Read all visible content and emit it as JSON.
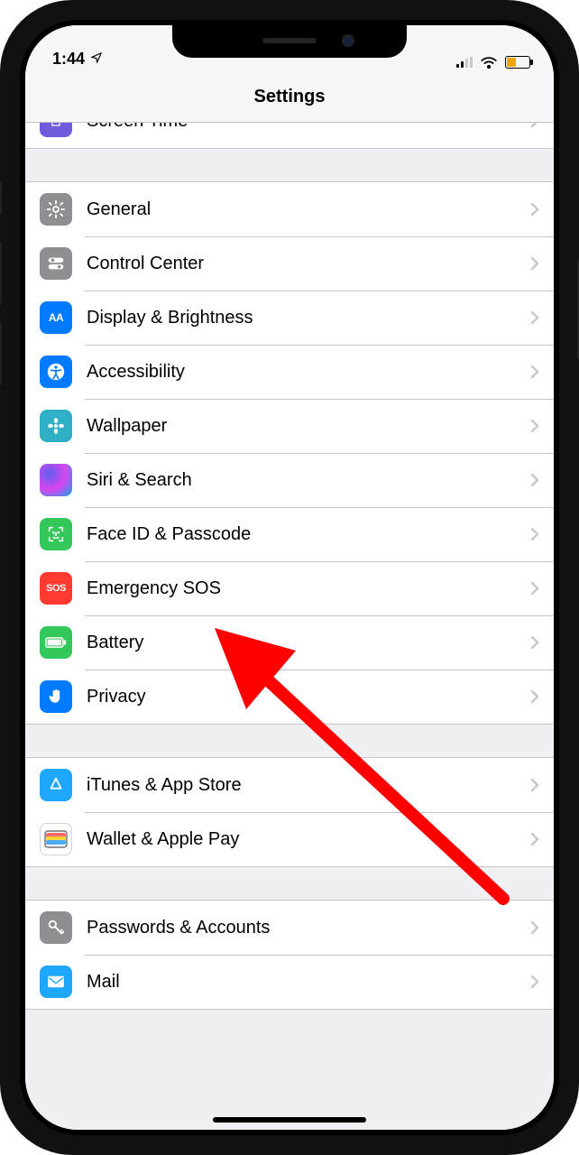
{
  "statusbar": {
    "time": "1:44",
    "location_services": true,
    "cell_bars": 2,
    "wifi": true,
    "battery_color": "#f0a500",
    "battery_low_power": true
  },
  "header": {
    "title": "Settings"
  },
  "groups": [
    {
      "rows": [
        {
          "id": "screen-time",
          "label": "Screen Time",
          "icon": "hourglass-icon",
          "icon_bg": "#6f5bdc"
        }
      ]
    },
    {
      "rows": [
        {
          "id": "general",
          "label": "General",
          "icon": "gear-icon",
          "icon_bg": "#8e8e93"
        },
        {
          "id": "control-center",
          "label": "Control Center",
          "icon": "switches-icon",
          "icon_bg": "#8e8e93"
        },
        {
          "id": "display",
          "label": "Display & Brightness",
          "icon": "text-size-icon",
          "icon_bg": "#007aff"
        },
        {
          "id": "accessibility",
          "label": "Accessibility",
          "icon": "accessibility-icon",
          "icon_bg": "#007aff"
        },
        {
          "id": "wallpaper",
          "label": "Wallpaper",
          "icon": "flower-icon",
          "icon_bg": "#30b0c7"
        },
        {
          "id": "siri",
          "label": "Siri & Search",
          "icon": "siri-icon",
          "icon_bg": "grad"
        },
        {
          "id": "faceid",
          "label": "Face ID & Passcode",
          "icon": "faceid-icon",
          "icon_bg": "#34c759"
        },
        {
          "id": "sos",
          "label": "Emergency SOS",
          "icon": "sos-icon",
          "icon_bg": "#ff3b30"
        },
        {
          "id": "battery",
          "label": "Battery",
          "icon": "battery-icon",
          "icon_bg": "#34c759"
        },
        {
          "id": "privacy",
          "label": "Privacy",
          "icon": "hand-icon",
          "icon_bg": "#007aff"
        }
      ]
    },
    {
      "rows": [
        {
          "id": "itunes",
          "label": "iTunes & App Store",
          "icon": "appstore-icon",
          "icon_bg": "#1ea7fd"
        },
        {
          "id": "wallet",
          "label": "Wallet & Apple Pay",
          "icon": "wallet-icon",
          "icon_bg": "white"
        }
      ]
    },
    {
      "rows": [
        {
          "id": "passwords",
          "label": "Passwords & Accounts",
          "icon": "key-icon",
          "icon_bg": "#8e8e93"
        },
        {
          "id": "mail",
          "label": "Mail",
          "icon": "mail-icon",
          "icon_bg": "#1ea7fd"
        }
      ]
    }
  ],
  "annotation": {
    "type": "arrow",
    "color": "#ff0000",
    "target": "battery"
  }
}
